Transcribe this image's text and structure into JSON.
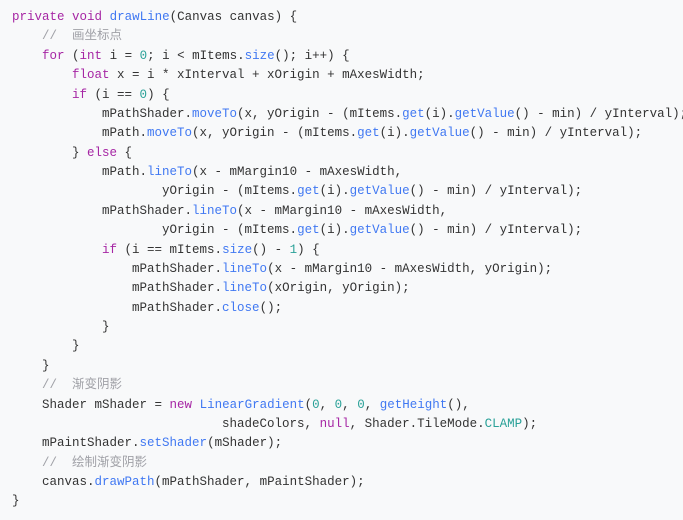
{
  "code": {
    "l1": {
      "kw1": "private",
      "kw2": "void",
      "fn": "drawLine",
      "p1": "(Canvas canvas) {"
    },
    "l2": {
      "cmt": "//  画坐标点"
    },
    "l3": {
      "kw1": "for",
      "p1": " (",
      "kw2": "int",
      "p2": " i = ",
      "n1": "0",
      "p3": "; i < mItems.",
      "fn1": "size",
      "p4": "(); i++) {"
    },
    "l4": {
      "kw1": "float",
      "p1": " x = i * xInterval + xOrigin + mAxesWidth;"
    },
    "l5": {
      "kw1": "if",
      "p1": " (i == ",
      "n1": "0",
      "p2": ") {"
    },
    "l6": {
      "p1": "mPathShader.",
      "fn1": "moveTo",
      "p2": "(x, yOrigin - (mItems.",
      "fn2": "get",
      "p3": "(i).",
      "fn3": "getValue",
      "p4": "() - min) / yInterval);"
    },
    "l7": {
      "p1": "mPath.",
      "fn1": "moveTo",
      "p2": "(x, yOrigin - (mItems.",
      "fn2": "get",
      "p3": "(i).",
      "fn3": "getValue",
      "p4": "() - min) / yInterval);"
    },
    "l8": {
      "p1": "} ",
      "kw1": "else",
      "p2": " {"
    },
    "l9": {
      "p1": "mPath.",
      "fn1": "lineTo",
      "p2": "(x - mMargin10 - mAxesWidth,"
    },
    "l10": {
      "p1": "yOrigin - (mItems.",
      "fn1": "get",
      "p2": "(i).",
      "fn2": "getValue",
      "p3": "() - min) / yInterval);"
    },
    "l11": {
      "p1": "mPathShader.",
      "fn1": "lineTo",
      "p2": "(x - mMargin10 - mAxesWidth,"
    },
    "l12": {
      "p1": "yOrigin - (mItems.",
      "fn1": "get",
      "p2": "(i).",
      "fn2": "getValue",
      "p3": "() - min) / yInterval);"
    },
    "l13": {
      "kw1": "if",
      "p1": " (i == mItems.",
      "fn1": "size",
      "p2": "() - ",
      "n1": "1",
      "p3": ") {"
    },
    "l14": {
      "p1": "mPathShader.",
      "fn1": "lineTo",
      "p2": "(x - mMargin10 - mAxesWidth, yOrigin);"
    },
    "l15": {
      "p1": "mPathShader.",
      "fn1": "lineTo",
      "p2": "(xOrigin, yOrigin);"
    },
    "l16": {
      "p1": "mPathShader.",
      "fn1": "close",
      "p2": "();"
    },
    "l17": {
      "p1": "}"
    },
    "l18": {
      "p1": "}"
    },
    "l19": {
      "p1": "}"
    },
    "l20": {
      "cmt": "//  渐变阴影"
    },
    "l21": {
      "p1": "Shader mShader = ",
      "kw1": "new",
      "p2": " ",
      "fn1": "LinearGradient",
      "p3": "(",
      "n1": "0",
      "p4": ", ",
      "n2": "0",
      "p5": ", ",
      "n3": "0",
      "p6": ", ",
      "fn2": "getHeight",
      "p7": "(),"
    },
    "l22": {
      "p1": "shadeColors, ",
      "kw1": "null",
      "p2": ", Shader.TileMode.",
      "const1": "CLAMP",
      "p3": ");"
    },
    "l23": {
      "p1": "mPaintShader.",
      "fn1": "setShader",
      "p2": "(mShader);"
    },
    "l24": {
      "cmt": "//  绘制渐变阴影"
    },
    "l25": {
      "p1": "canvas.",
      "fn1": "drawPath",
      "p2": "(mPathShader, mPaintShader);"
    },
    "l26": {
      "p1": "}"
    }
  }
}
